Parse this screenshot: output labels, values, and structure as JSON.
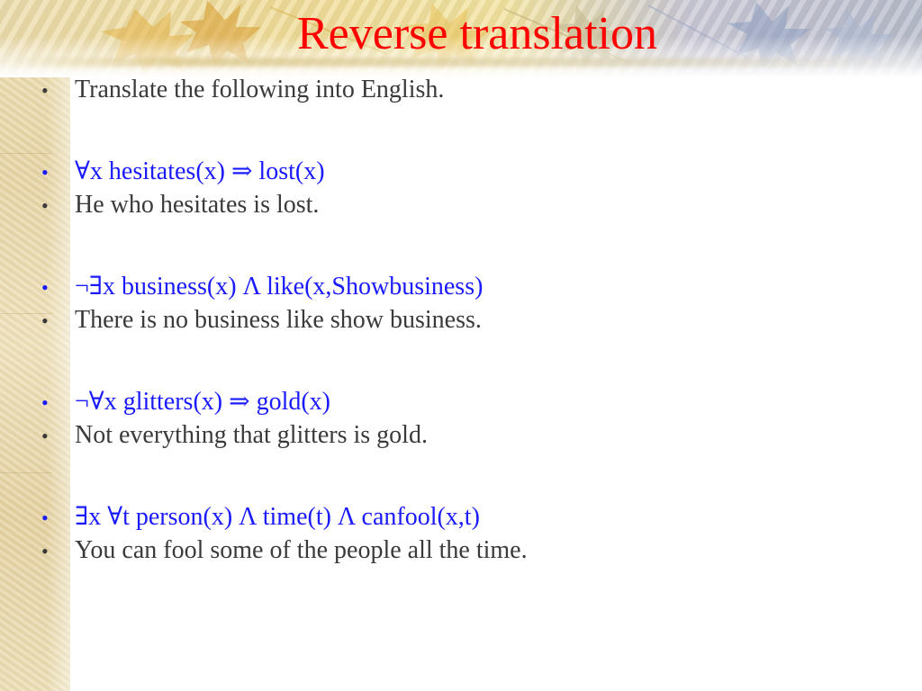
{
  "slide": {
    "title": "Reverse translation",
    "bullet_glyph": "•",
    "bullets": [
      {
        "text": "Translate the following into English.",
        "kind": "instruction"
      },
      {
        "text": "∀x hesitates(x) ⇒ lost(x)",
        "kind": "formula"
      },
      {
        "text": "He who hesitates is lost.",
        "kind": "sentence"
      },
      {
        "text": "¬∃x business(x) Λ like(x,Showbusiness)",
        "kind": "formula"
      },
      {
        "text": "There is no business like show business.",
        "kind": "sentence"
      },
      {
        "text": "¬∀x glitters(x) ⇒ gold(x)",
        "kind": "formula"
      },
      {
        "text": "Not everything that glitters is gold.",
        "kind": "sentence"
      },
      {
        "text": "∃x ∀t person(x) Λ time(t) Λ canfool(x,t)",
        "kind": "formula"
      },
      {
        "text": "You can fool some of the people all the time.",
        "kind": "sentence"
      }
    ]
  },
  "colors": {
    "title": "#ff0000",
    "formula_text": "#1a1aff",
    "body_text": "#3a3a3a",
    "background": "#ffffff"
  }
}
